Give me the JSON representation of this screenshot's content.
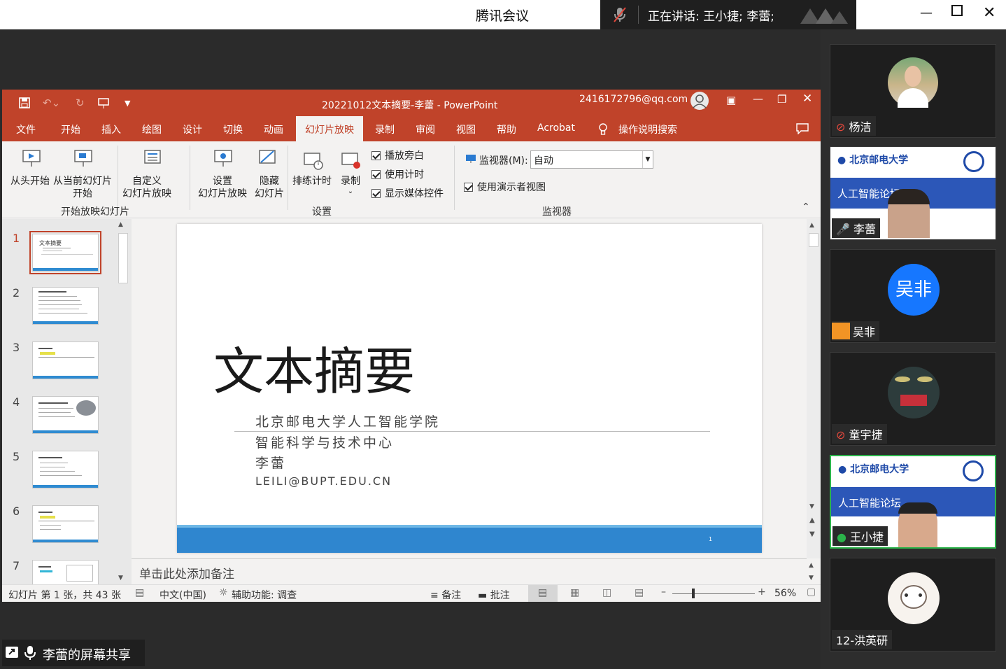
{
  "meeting": {
    "app_title": "腾讯会议",
    "speaking": "正在讲话: 王小捷; 李蕾;"
  },
  "ppt": {
    "doc_title": "20221012文本摘要-李蕾  -  PowerPoint",
    "account": "2416172796@qq.com",
    "tabs": [
      "文件",
      "开始",
      "插入",
      "绘图",
      "设计",
      "切换",
      "动画",
      "幻灯片放映",
      "录制",
      "审阅",
      "视图",
      "帮助",
      "Acrobat",
      "操作说明搜索"
    ],
    "ribbon": {
      "from_start": "从头开始",
      "from_current": "从当前幻灯片",
      "from_current2": "开始",
      "custom": "自定义",
      "custom2": "幻灯片放映",
      "group1": "开始放映幻灯片",
      "setup": "设置",
      "setup2": "幻灯片放映",
      "hide": "隐藏",
      "hide2": "幻灯片",
      "rehearse": "排练计时",
      "record": "录制",
      "narration": "播放旁白",
      "timings": "使用计时",
      "media": "显示媒体控件",
      "group2": "设置",
      "monitor_label": "监视器(M):",
      "monitor_value": "自动",
      "presenter": "使用演示者视图",
      "group3": "监视器"
    },
    "thumb_numbers": [
      "1",
      "2",
      "3",
      "4",
      "5",
      "6",
      "7"
    ],
    "slide": {
      "title": "文本摘要",
      "line1": "北京邮电大学人工智能学院",
      "line2": "智能科学与技术中心",
      "line3": "李蕾",
      "line4": "LEILI@BUPT.EDU.CN",
      "page": "1"
    },
    "notes_placeholder": "单击此处添加备注",
    "status": {
      "slide_count": "幻灯片 第 1 张，共 43 张",
      "lang": "中文(中国)",
      "accessibility": "辅助功能: 调查",
      "notes": "备注",
      "comments": "批注",
      "zoom": "56%"
    }
  },
  "share_label": "李蕾的屏幕共享",
  "participants": [
    {
      "name": "杨洁"
    },
    {
      "name": "李蕾",
      "banner": "人工智能论坛"
    },
    {
      "name": "吴非",
      "avatar_text": "吴非"
    },
    {
      "name": "童宇捷"
    },
    {
      "name": "王小捷",
      "banner": "人工智能论坛"
    },
    {
      "name": "12-洪英研"
    }
  ]
}
